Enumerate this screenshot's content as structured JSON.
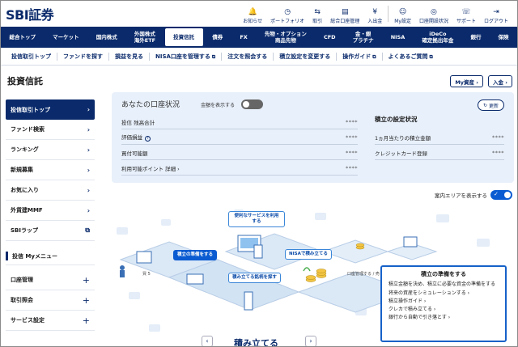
{
  "header": {
    "logo": "SBI証券",
    "icons": [
      {
        "label": "お知らせ",
        "glyph": "🔔",
        "icon": "bell-icon"
      },
      {
        "label": "ポートフォリオ",
        "glyph": "◷",
        "icon": "portfolio-icon"
      },
      {
        "label": "取引",
        "glyph": "⇆",
        "icon": "trade-icon"
      },
      {
        "label": "総合口座管理",
        "glyph": "▤",
        "icon": "account-icon"
      },
      {
        "label": "入出金",
        "glyph": "¥",
        "icon": "deposit-icon"
      },
      {
        "label": "My設定",
        "glyph": "☺",
        "icon": "user-icon"
      },
      {
        "label": "口座開設状況",
        "glyph": "◎",
        "icon": "status-icon"
      },
      {
        "label": "サポート",
        "glyph": "☏",
        "icon": "support-icon"
      },
      {
        "label": "ログアウト",
        "glyph": "⇥",
        "icon": "logout-icon"
      }
    ]
  },
  "mainnav": [
    "総合トップ",
    "マーケット",
    "国内株式",
    "外国株式\n海外ETF",
    "投資信託",
    "債券",
    "FX",
    "先物・オプション\n商品先物",
    "CFD",
    "金・銀\nプラチナ",
    "NISA",
    "iDeCo\n確定拠出年金",
    "銀行",
    "保険"
  ],
  "mainnav_active": "投資信託",
  "subnav": [
    {
      "label": "投信取引トップ",
      "ext": false
    },
    {
      "label": "ファンドを探す",
      "ext": false
    },
    {
      "label": "損益を見る",
      "ext": false
    },
    {
      "label": "NISA口座を管理する",
      "ext": true
    },
    {
      "label": "注文を照会する",
      "ext": false
    },
    {
      "label": "積立設定を変更する",
      "ext": false
    },
    {
      "label": "操作ガイド",
      "ext": true
    },
    {
      "label": "よくあるご質問",
      "ext": true
    }
  ],
  "page_title": "投資信託",
  "buttons": {
    "my_assets": "My資産 ›",
    "deposit": "入金 ›"
  },
  "sidebar": {
    "items": [
      {
        "label": "投信取引トップ",
        "mark": "›",
        "active": true
      },
      {
        "label": "ファンド検索",
        "mark": "›"
      },
      {
        "label": "ランキング",
        "mark": "›"
      },
      {
        "label": "新規募集",
        "mark": "›"
      },
      {
        "label": "お気に入り",
        "mark": "›"
      },
      {
        "label": "外貨建MMF",
        "mark": "›"
      },
      {
        "label": "SBIラップ",
        "mark": "⧉"
      }
    ],
    "menu_title": "投信 Myメニュー",
    "menu_items": [
      {
        "label": "口座管理",
        "mark": "+"
      },
      {
        "label": "取引照会",
        "mark": "+"
      },
      {
        "label": "サービス設定",
        "mark": "+"
      }
    ]
  },
  "account": {
    "title": "あなたの口座状況",
    "toggle_label": "金額を表示する",
    "refresh_label": "更新",
    "rows": [
      {
        "label": "投信 残高合計",
        "value": "****"
      },
      {
        "label": "評価損益",
        "value": "****"
      },
      {
        "label": "買付可能額",
        "value": "****"
      },
      {
        "label": "利用可能ポイント",
        "link": "詳細 ›",
        "value": "****"
      }
    ],
    "settings_title": "積立の設定状況",
    "settings_rows": [
      {
        "label": "1ヵ月当たりの積立金額",
        "value": "****"
      },
      {
        "label": "クレジットカード登録",
        "value": "****"
      }
    ]
  },
  "guide_toggle_label": "案内エリアを表示する",
  "illustration": {
    "bubbles": {
      "b1": "便利なサービスを利用\nする",
      "b2": "積立の準備をする",
      "b3": "NISAで積み立てる",
      "b4": "積み立てる銘柄を探す"
    },
    "captions": {
      "c1": "買 5",
      "c2": "口座管理する / 売・"
    },
    "step_title": "積み立てる"
  },
  "info": {
    "title": "積立の準備をする",
    "desc": "積立金額を決め、積立に必要な資金の準備をする",
    "links": [
      "将来の資産をシミュレーションする ›",
      "積立操作ガイド ›",
      "クレカで積み立てる ›",
      "銀行から自動で引き落とす ›"
    ]
  },
  "colors": {
    "navy": "#0a2a6b",
    "card_bg": "#e8f0fb",
    "accent": "#0a5bd1"
  }
}
